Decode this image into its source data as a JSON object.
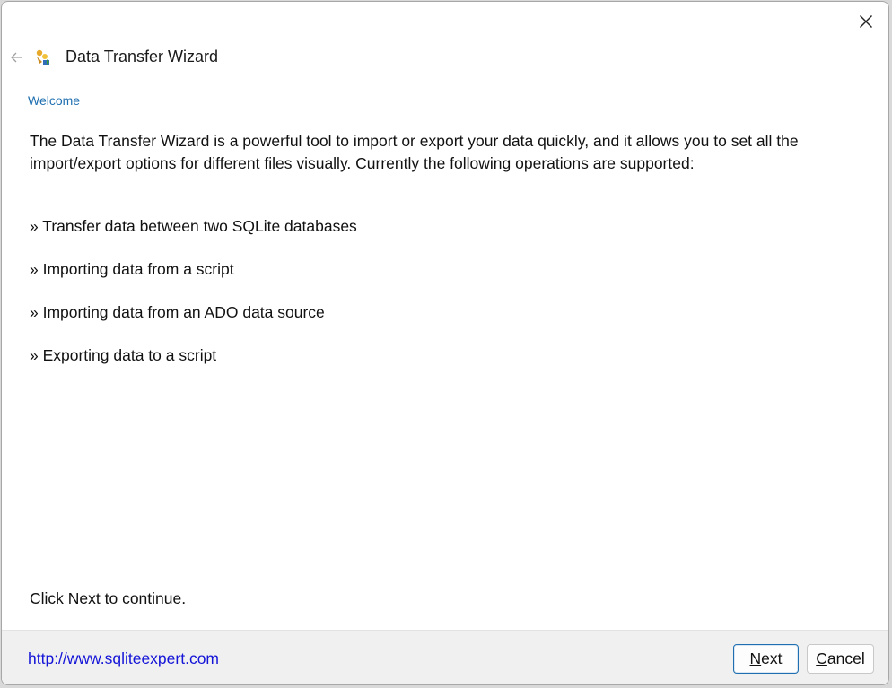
{
  "window": {
    "title": "Data Transfer Wizard",
    "close_icon": "close-icon",
    "back_icon": "back-arrow-icon",
    "app_icon": "wizard-app-icon"
  },
  "page": {
    "step_label": "Welcome",
    "intro": "The Data Transfer Wizard is a powerful tool to import or export your data quickly, and it allows you to set all the import/export options for different files visually. Currently the following operations are supported:",
    "operations": [
      "» Transfer data between two SQLite databases",
      "» Importing data from a script",
      "» Importing data from an ADO data source",
      "» Exporting data to a script"
    ],
    "continue_hint": "Click Next to continue."
  },
  "footer": {
    "link_text": "http://www.sqliteexpert.com",
    "next_mnemonic": "N",
    "next_rest": "ext",
    "cancel_mnemonic": "C",
    "cancel_rest": "ancel"
  },
  "colors": {
    "accent": "#1f6fb0",
    "link": "#1515d8",
    "footer_bg": "#f0f0f0"
  }
}
